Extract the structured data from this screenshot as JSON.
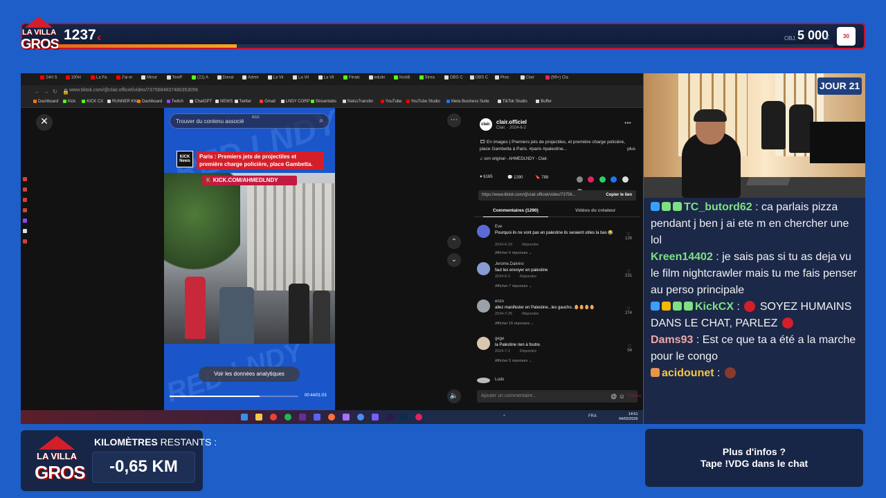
{
  "overlay": {
    "logo_line1": "LA VILLA",
    "logo_line2": "GROS",
    "counter": "1237",
    "counter_suffix": "€",
    "goal_label": "OBJ.",
    "goal_value": "5 000",
    "goal_currency": "€",
    "goal_progress": 0.23,
    "progress_color": "#f7a522",
    "badge_text": "30",
    "day_label": "JOUR 21"
  },
  "browser": {
    "tabs": [
      "24H S",
      "100H",
      "La Fa",
      "J'ai er",
      "Minut",
      "TextP",
      "(21) A",
      "Donat",
      "Admir",
      "La Vil",
      "La Vil",
      "La Vil",
      "Finalc",
      "edulin",
      "KickB",
      "Strea",
      "OBS C",
      "OBS C",
      "Pisic",
      "Clair",
      "(99+) Cla"
    ],
    "url": "www.tiktok.com/@clair.officiel/video/7375684837480353056",
    "bookmarks": [
      "Dashboard",
      "Kick",
      "KICK CX",
      "RUNNER KN",
      "Dashboard",
      "Twitch",
      "ChatGPT",
      "NEWS",
      "Twitter",
      "Gmail",
      "LNDY CORP",
      "Streamlabs",
      "SwissTransfer",
      "YouTube",
      "YouTube Studio",
      "Meta Business Suite",
      "TikTok Studio",
      "Buffer"
    ]
  },
  "video": {
    "search_placeholder": "Trouver du contenu associé",
    "rgx": "RGX",
    "kick_news": "KICK News",
    "headline": "Paris : Premiers jets de projectiles et première charge policière, place Gambetta.",
    "kick_banner_k": "K",
    "kick_banner": "KICK.COM/AHMEDLNDY",
    "analytics_label": "Voir les données analytiques",
    "progress": 0.7,
    "time": "00:44/01:03"
  },
  "post": {
    "account_logo": "clair.",
    "account": "clair.officiel",
    "account_sub": "Clair. · 2024-6-2",
    "description": "🎞 En images | Premiers jets de projectiles, et première charge policière, place Gambetta à Paris. #paris #palestine...",
    "more": "plus",
    "sound": "♫ son original - AHMEDLNDY - Clair.",
    "likes": "6165",
    "comments": "1290",
    "saves": "788",
    "link": "https://www.tiktok.com/@clair.officiel/video/73756...",
    "copy_link": "Copier le lien",
    "tab_comments": "Commentaires (1290)",
    "tab_creator": "Vidéos du créateur",
    "comment_list": [
      {
        "name": "Eve",
        "text": "Pourquoi ils ne vont pas en palestine ils seraient utiles la bas 😂",
        "date": "2024-6-23",
        "reply": "Répondre",
        "more": "Afficher 6 réponses ⌄",
        "likes": "126",
        "color": "#5b6bd6"
      },
      {
        "name": "Jerome.Dalvino",
        "text": "faut les envoyer en palestine",
        "date": "2024-6-2",
        "reply": "Répondre",
        "more": "Afficher 7 réponses ⌄",
        "likes": "231",
        "color": "#8a9bd1"
      },
      {
        "name": "enzo",
        "text": "allez manifester en Palestine...les gaucho..🥚🥚🥚🥚",
        "date": "2024-7-25",
        "reply": "Répondre",
        "more": "Afficher 16 réponses ⌄",
        "likes": "274",
        "color": "#9aa1a8"
      },
      {
        "name": "gege",
        "text": "la Palestine rien à foutre.",
        "date": "2024-7-1",
        "reply": "Répondre",
        "more": "Afficher 5 réponses ⌄",
        "likes": "54",
        "color": "#d8c7b0"
      }
    ],
    "next_name": "Ludo",
    "add_comment": "Ajouter un commentaire...",
    "publish": "Publier"
  },
  "taskbar": {
    "lang": "FRA",
    "time": "14:51",
    "date": "04/02/2026"
  },
  "chat": [
    {
      "user": "TC_butord62",
      "sep": " : ",
      "text": "ca parlais pizza pendant j ben j ai ete m en chercher une lol",
      "color": "#7ee081",
      "badges": [
        "#3aa0ff",
        "#7ee081",
        "#7ee081"
      ]
    },
    {
      "user": "Kreen14402",
      "sep": " : ",
      "text": "je sais pas si tu as deja vu le film nightcrawler mais tu me fais penser au perso principale",
      "color": "#7ee081",
      "badges": []
    },
    {
      "user": "KickCX",
      "sep": " : ",
      "text": " SOYEZ HUMAINS DANS LE CHAT, PARLEZ ",
      "color": "#7ee081",
      "badges": [
        "#3aa0ff",
        "#f5b800",
        "#7ee081",
        "#7ee081"
      ]
    },
    {
      "user": "Dams93",
      "sep": " : ",
      "text": "Est ce que ta a été a la marche pour le congo",
      "color": "#f0a8a8",
      "badges": []
    },
    {
      "user": "acidounet",
      "sep": " : ",
      "text": "",
      "color": "#f5c542",
      "badges": [
        "#e8954a"
      ]
    }
  ],
  "km": {
    "title_bold": "KILOMÈTRES",
    "title_light": " RESTANTS :",
    "value": "-0,65 KM"
  },
  "info": {
    "line1": "Plus d'infos ?",
    "line2": "Tape !VDG dans le chat"
  }
}
